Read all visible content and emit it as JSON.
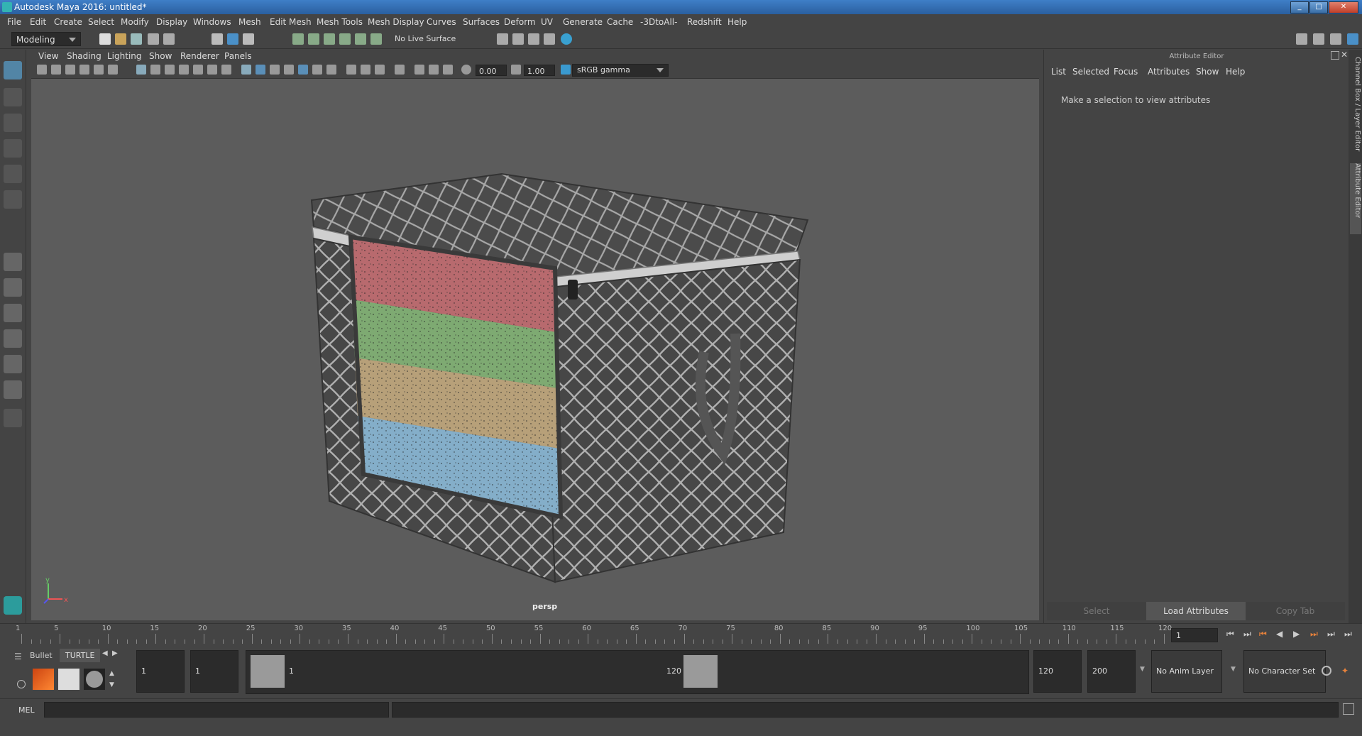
{
  "window": {
    "title": "Autodesk Maya 2016: untitled*",
    "controls": [
      "_",
      "□",
      "✕"
    ]
  },
  "menubar": {
    "items": [
      "File",
      "Edit",
      "Create",
      "Select",
      "Modify",
      "Display",
      "Windows",
      "Mesh",
      "Edit Mesh",
      "Mesh Tools",
      "Mesh Display",
      "Curves",
      "Surfaces",
      "Deform",
      "UV",
      "Generate",
      "Cache",
      "-3DtoAll-",
      "Redshift",
      "Help"
    ]
  },
  "statusline": {
    "mode": "Modeling",
    "live_surface": "No Live Surface"
  },
  "viewport": {
    "menus": [
      "View",
      "Shading",
      "Lighting",
      "Show",
      "Renderer",
      "Panels"
    ],
    "exposure": "0.00",
    "gamma": "1.00",
    "color_space": "sRGB gamma",
    "camera_label": "persp",
    "axis": {
      "y": "y",
      "x": "x"
    }
  },
  "attribute_editor": {
    "title": "Attribute Editor",
    "menus": [
      "List",
      "Selected",
      "Focus",
      "Attributes",
      "Show",
      "Help"
    ],
    "message": "Make a selection to view attributes",
    "buttons": {
      "select": "Select",
      "load": "Load Attributes",
      "copy": "Copy Tab"
    }
  },
  "side_tabs": [
    "Channel Box / Layer Editor",
    "Attribute Editor"
  ],
  "time_slider": {
    "tick_labels": [
      "1",
      "5",
      "10",
      "15",
      "20",
      "25",
      "30",
      "35",
      "40",
      "45",
      "50",
      "55",
      "60",
      "65",
      "70",
      "75",
      "80",
      "85",
      "90",
      "95",
      "100",
      "105",
      "110",
      "115",
      "120"
    ],
    "current_frame": "1"
  },
  "range_slider": {
    "shelf_tabs": [
      "Bullet",
      "TURTLE"
    ],
    "start_frame": "1",
    "playback_start": "1",
    "range_start_label": "1",
    "range_end_label": "120",
    "playback_end": "120",
    "end_frame": "200",
    "anim_layer": "No Anim Layer",
    "character_set": "No Character Set"
  },
  "command_line": {
    "language": "MEL"
  }
}
